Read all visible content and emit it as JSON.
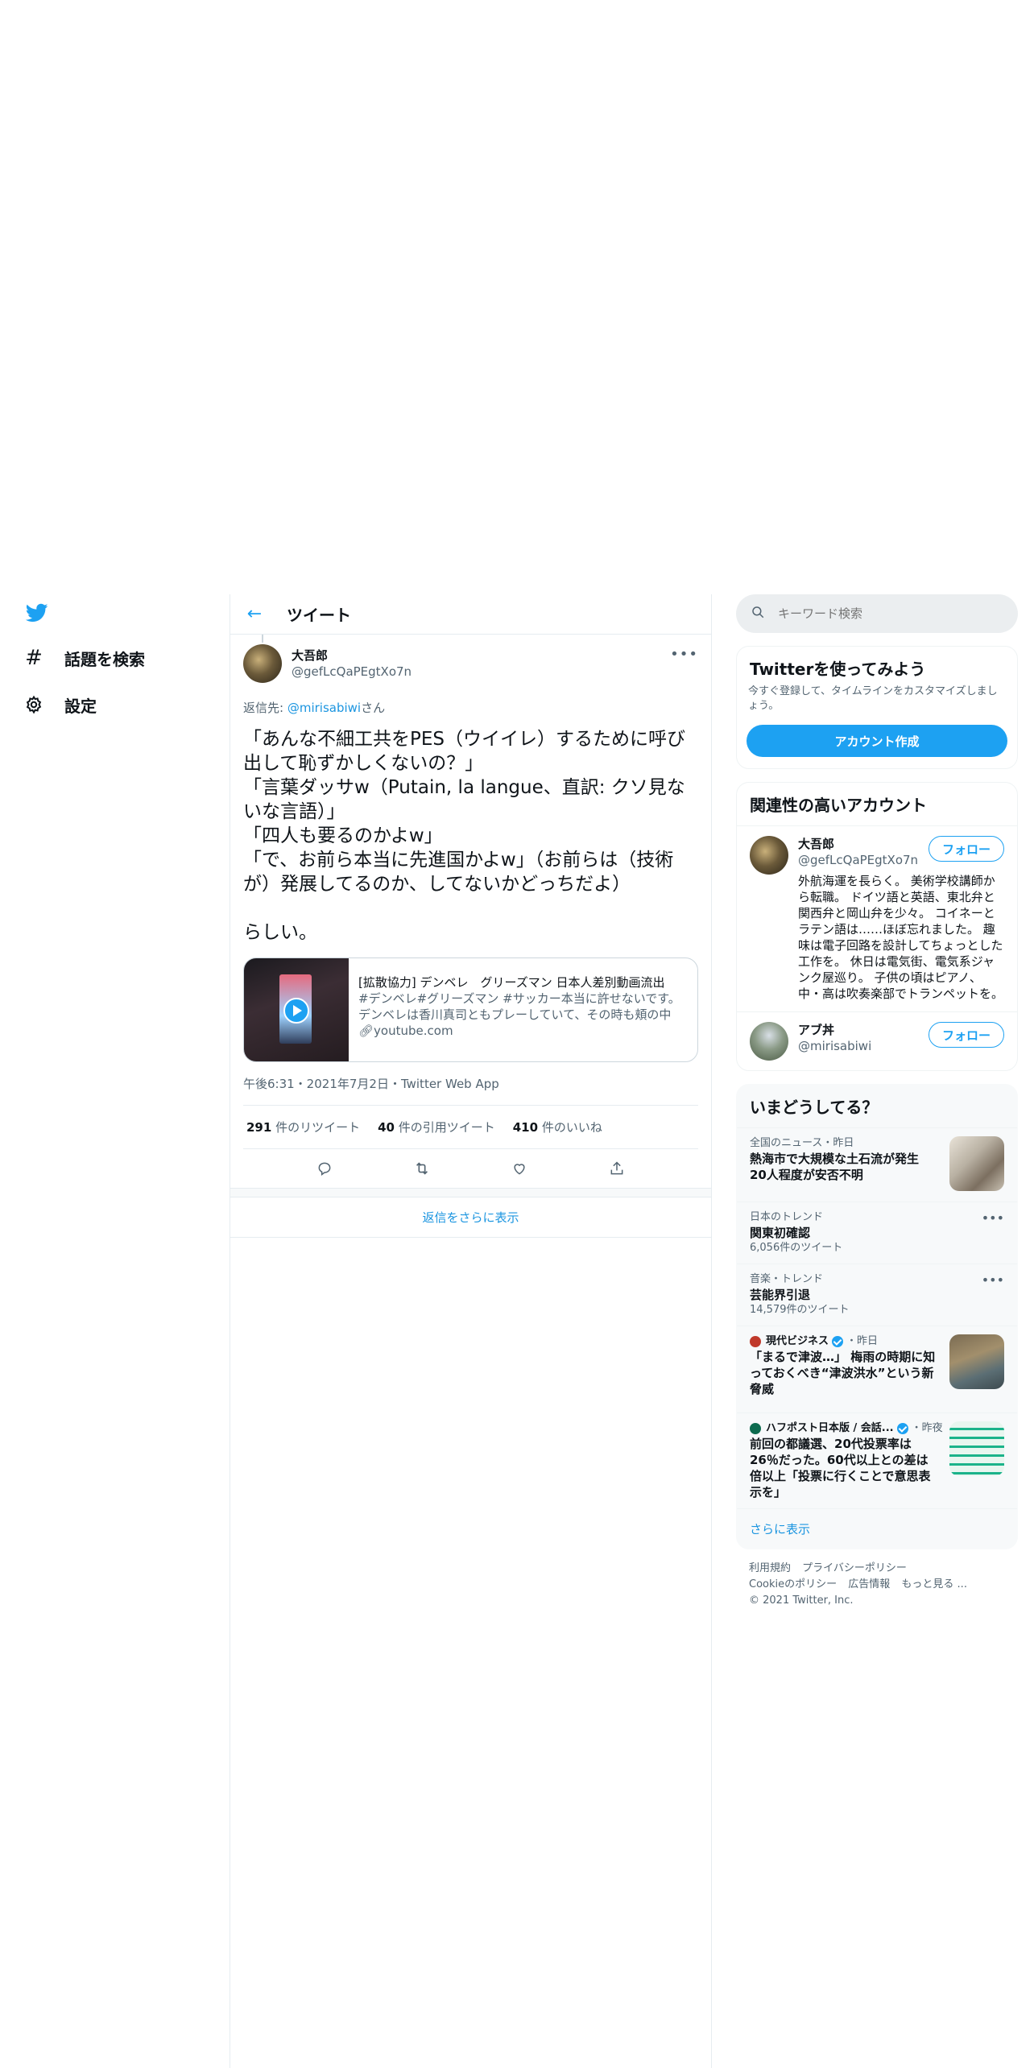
{
  "nav": {
    "items": [
      {
        "label": "話題を検索",
        "icon": "hashtag-icon"
      },
      {
        "label": "設定",
        "icon": "gear-icon"
      }
    ]
  },
  "header": {
    "title": "ツイート"
  },
  "tweet": {
    "author_name": "大吾郎",
    "author_handle": "@gefLcQaPEgtXo7n",
    "reply_prefix": "返信先: ",
    "reply_mention": "@mirisabiwi",
    "reply_suffix": "さん",
    "lines": [
      "「あんな不細工共をPES（ウイイレ）するために呼び出して恥ずかしくないの？」",
      "「言葉ダッサw（Putain, la langue、直訳: クソ見ないな言語）」",
      "「四人も要るのかよw」",
      "「で、お前ら本当に先進国かよw」（お前らは（技術が）発展してるのか、してないかどっちだよ）",
      "らしい。"
    ],
    "card": {
      "title": "[拡散協力] デンベレ　グリーズマン 日本人差別動画流出",
      "description": "#デンベレ#グリーズマン #サッカー本当に許せないです。デンベレは香川真司ともプレーしていて、その時も頬の中で…",
      "domain": "youtube.com"
    },
    "meta": "午後6:31・2021年7月2日・Twitter Web App",
    "retweets": "291",
    "retweets_label": " 件のリツイート",
    "quotes": "40",
    "quotes_label": " 件の引用ツイート",
    "likes": "410",
    "likes_label": " 件のいいね"
  },
  "show_more_replies": "返信をさらに表示",
  "search": {
    "placeholder": "キーワード検索"
  },
  "signup": {
    "title": "Twitterを使ってみよう",
    "subtitle": "今すぐ登録して、タイムラインをカスタマイズしましょう。",
    "button": "アカウント作成"
  },
  "related": {
    "title": "関連性の高いアカウント",
    "accounts": [
      {
        "name": "大吾郎",
        "handle": "@gefLcQaPEgtXo7n",
        "bio": "外航海運を長らく。 美術学校講師から転職。 ドイツ語と英語、東北弁と関西弁と岡山弁を少々。 コイネーとラテン語は……ほぼ忘れました。 趣味は電子回路を設計してちょっとした工作を。 休日は電気街、電気系ジャンク屋巡り。 子供の頃はピアノ、中・高は吹奏楽部でトランペットを。 背景：白亜地に卵テンペラ・樹脂油彩",
        "follow": "フォロー"
      },
      {
        "name": "アブ丼",
        "handle": "@mirisabiwi",
        "bio": "",
        "follow": "フォロー"
      }
    ]
  },
  "trends": {
    "title": "いまどうしてる？",
    "items": [
      {
        "context": "全国のニュース・昨日",
        "title": "熱海市で大規模な土石流が発生 20人程度が安否不明"
      },
      {
        "context": "日本のトレンド",
        "title": "関東初確認",
        "count": "6,056件のツイート"
      },
      {
        "context": "音楽・トレンド",
        "title": "芸能界引退",
        "count": "14,579件のツイート"
      },
      {
        "source": "現代ビジネス",
        "time": "・昨日",
        "title": "「まるで津波…」 梅雨の時期に知っておくべき“津波洪水”という新脅威"
      },
      {
        "source": "ハフポスト日本版 / 会話...",
        "time": "・昨夜",
        "title": "前回の都議選、20代投票率は26％だった。60代以上との差は倍以上「投票に行くことで意思表示を」"
      }
    ],
    "show_more": "さらに表示"
  },
  "footer": {
    "links": [
      "利用規約",
      "プライバシーポリシー",
      "Cookieのポリシー",
      "広告情報",
      "もっと見る ..."
    ],
    "copyright": "© 2021 Twitter, Inc."
  },
  "colors": {
    "accent": "#1da1f2",
    "link": "#1b95e0",
    "text": "#0f1419",
    "muted": "#536471"
  }
}
